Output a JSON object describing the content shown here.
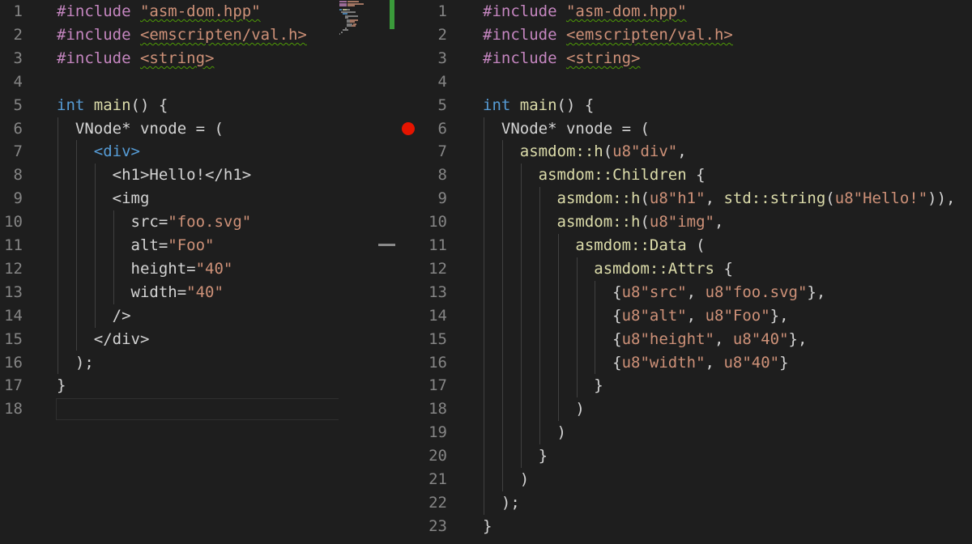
{
  "colors": {
    "background": "#1e1e1e",
    "line_number": "#858585",
    "keyword": "#c586c0",
    "type": "#569cd6",
    "function": "#dcdcaa",
    "string": "#ce9178",
    "attribute": "#9cdcfe",
    "plain": "#d4d4d4",
    "breakpoint": "#e51400",
    "change_bar": "#3a9a3a",
    "squiggle": "#4e9a06"
  },
  "left_editor": {
    "lines": [
      {
        "n": "1",
        "tokens": [
          [
            "#include",
            "kw"
          ],
          [
            " ",
            "plain"
          ],
          [
            "\"asm-dom.hpp\"",
            "str"
          ]
        ],
        "squiggle": true
      },
      {
        "n": "2",
        "tokens": [
          [
            "#include",
            "kw"
          ],
          [
            " ",
            "plain"
          ],
          [
            "<emscripten/val.h>",
            "str"
          ]
        ],
        "squiggle": true
      },
      {
        "n": "3",
        "tokens": [
          [
            "#include",
            "kw"
          ],
          [
            " ",
            "plain"
          ],
          [
            "<string>",
            "str"
          ]
        ],
        "squiggle": true
      },
      {
        "n": "4",
        "tokens": []
      },
      {
        "n": "5",
        "tokens": [
          [
            "int",
            "type"
          ],
          [
            " ",
            "plain"
          ],
          [
            "main",
            "fn"
          ],
          [
            "() {",
            "plain"
          ]
        ]
      },
      {
        "n": "6",
        "tokens": [
          [
            "  VNode* vnode = (",
            "plain"
          ]
        ]
      },
      {
        "n": "7",
        "tokens": [
          [
            "    ",
            "plain"
          ],
          [
            "<div>",
            "tag"
          ]
        ]
      },
      {
        "n": "8",
        "tokens": [
          [
            "      <h1>Hello!</h1>",
            "plain"
          ]
        ]
      },
      {
        "n": "9",
        "tokens": [
          [
            "      <img",
            "plain"
          ]
        ]
      },
      {
        "n": "10",
        "tokens": [
          [
            "        src=",
            "plain"
          ],
          [
            "\"foo.svg\"",
            "str"
          ]
        ]
      },
      {
        "n": "11",
        "tokens": [
          [
            "        alt=",
            "plain"
          ],
          [
            "\"Foo\"",
            "str"
          ]
        ]
      },
      {
        "n": "12",
        "tokens": [
          [
            "        height=",
            "plain"
          ],
          [
            "\"40\"",
            "str"
          ]
        ]
      },
      {
        "n": "13",
        "tokens": [
          [
            "        width=",
            "plain"
          ],
          [
            "\"40\"",
            "str"
          ]
        ]
      },
      {
        "n": "14",
        "tokens": [
          [
            "      />",
            "plain"
          ]
        ]
      },
      {
        "n": "15",
        "tokens": [
          [
            "    </div>",
            "plain"
          ]
        ]
      },
      {
        "n": "16",
        "tokens": [
          [
            "  );",
            "plain"
          ]
        ]
      },
      {
        "n": "17",
        "tokens": [
          [
            "}",
            "plain"
          ]
        ]
      },
      {
        "n": "18",
        "tokens": []
      }
    ]
  },
  "right_editor": {
    "lines": [
      {
        "n": "1",
        "tokens": [
          [
            "#include",
            "kw"
          ],
          [
            " ",
            "plain"
          ],
          [
            "\"asm-dom.hpp\"",
            "str"
          ]
        ],
        "squiggle": true
      },
      {
        "n": "2",
        "tokens": [
          [
            "#include",
            "kw"
          ],
          [
            " ",
            "plain"
          ],
          [
            "<emscripten/val.h>",
            "str"
          ]
        ],
        "squiggle": true
      },
      {
        "n": "3",
        "tokens": [
          [
            "#include",
            "kw"
          ],
          [
            " ",
            "plain"
          ],
          [
            "<string>",
            "str"
          ]
        ],
        "squiggle": true
      },
      {
        "n": "4",
        "tokens": []
      },
      {
        "n": "5",
        "tokens": [
          [
            "int",
            "type"
          ],
          [
            " ",
            "plain"
          ],
          [
            "main",
            "fn"
          ],
          [
            "() {",
            "plain"
          ]
        ]
      },
      {
        "n": "6",
        "tokens": [
          [
            "  VNode* vnode = (",
            "plain"
          ]
        ]
      },
      {
        "n": "7",
        "tokens": [
          [
            "    ",
            "plain"
          ],
          [
            "asmdom::h",
            "fn"
          ],
          [
            "(",
            "plain"
          ],
          [
            "u8\"div\"",
            "str"
          ],
          [
            ",",
            "plain"
          ]
        ]
      },
      {
        "n": "8",
        "tokens": [
          [
            "      ",
            "plain"
          ],
          [
            "asmdom::Children",
            "fn"
          ],
          [
            " {",
            "plain"
          ]
        ]
      },
      {
        "n": "9",
        "tokens": [
          [
            "        ",
            "plain"
          ],
          [
            "asmdom::h",
            "fn"
          ],
          [
            "(",
            "plain"
          ],
          [
            "u8\"h1\"",
            "str"
          ],
          [
            ", ",
            "plain"
          ],
          [
            "std::string",
            "fn"
          ],
          [
            "(",
            "plain"
          ],
          [
            "u8\"Hello!\"",
            "str"
          ],
          [
            ")),",
            "plain"
          ]
        ]
      },
      {
        "n": "10",
        "tokens": [
          [
            "        ",
            "plain"
          ],
          [
            "asmdom::h",
            "fn"
          ],
          [
            "(",
            "plain"
          ],
          [
            "u8\"img\"",
            "str"
          ],
          [
            ",",
            "plain"
          ]
        ]
      },
      {
        "n": "11",
        "tokens": [
          [
            "          ",
            "plain"
          ],
          [
            "asmdom::Data",
            "fn"
          ],
          [
            " (",
            "plain"
          ]
        ]
      },
      {
        "n": "12",
        "tokens": [
          [
            "            ",
            "plain"
          ],
          [
            "asmdom::Attrs",
            "fn"
          ],
          [
            " {",
            "plain"
          ]
        ]
      },
      {
        "n": "13",
        "tokens": [
          [
            "              {",
            "plain"
          ],
          [
            "u8\"src\"",
            "str"
          ],
          [
            ", ",
            "plain"
          ],
          [
            "u8\"foo.svg\"",
            "str"
          ],
          [
            "},",
            "plain"
          ]
        ]
      },
      {
        "n": "14",
        "tokens": [
          [
            "              {",
            "plain"
          ],
          [
            "u8\"alt\"",
            "str"
          ],
          [
            ", ",
            "plain"
          ],
          [
            "u8\"Foo\"",
            "str"
          ],
          [
            "},",
            "plain"
          ]
        ]
      },
      {
        "n": "15",
        "tokens": [
          [
            "              {",
            "plain"
          ],
          [
            "u8\"height\"",
            "str"
          ],
          [
            ", ",
            "plain"
          ],
          [
            "u8\"40\"",
            "str"
          ],
          [
            "},",
            "plain"
          ]
        ]
      },
      {
        "n": "16",
        "tokens": [
          [
            "              {",
            "plain"
          ],
          [
            "u8\"width\"",
            "str"
          ],
          [
            ", ",
            "plain"
          ],
          [
            "u8\"40\"",
            "str"
          ],
          [
            "}",
            "plain"
          ]
        ]
      },
      {
        "n": "17",
        "tokens": [
          [
            "            }",
            "plain"
          ]
        ]
      },
      {
        "n": "18",
        "tokens": [
          [
            "          )",
            "plain"
          ]
        ]
      },
      {
        "n": "19",
        "tokens": [
          [
            "        )",
            "plain"
          ]
        ]
      },
      {
        "n": "20",
        "tokens": [
          [
            "      }",
            "plain"
          ]
        ]
      },
      {
        "n": "21",
        "tokens": [
          [
            "    )",
            "plain"
          ]
        ]
      },
      {
        "n": "22",
        "tokens": [
          [
            "  );",
            "plain"
          ]
        ]
      },
      {
        "n": "23",
        "tokens": [
          [
            "}",
            "plain"
          ]
        ]
      }
    ]
  }
}
